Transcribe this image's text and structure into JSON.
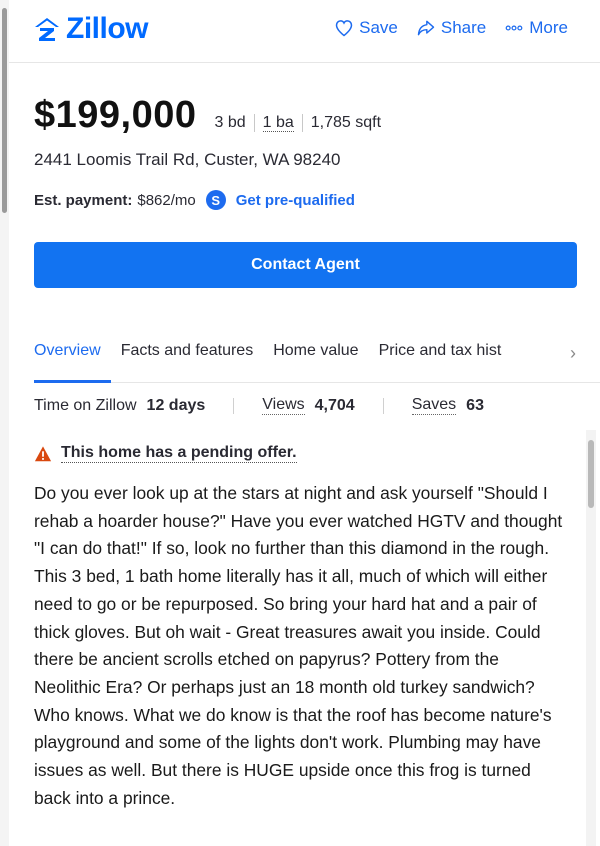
{
  "header": {
    "brand": "Zillow",
    "actions": [
      {
        "label": "Save",
        "icon": "heart-icon"
      },
      {
        "label": "Share",
        "icon": "share-icon"
      },
      {
        "label": "More",
        "icon": "more-dots-icon"
      }
    ]
  },
  "listing": {
    "price": "$199,000",
    "beds": "3 bd",
    "baths": "1 ba",
    "sqft": "1,785 sqft",
    "address": "2441 Loomis Trail Rd, Custer, WA 98240",
    "payment_label": "Est. payment:",
    "payment_value": "$862/mo",
    "prequal_icon_letter": "S",
    "prequal_link": "Get pre-qualified"
  },
  "contact": {
    "label": "Contact Agent"
  },
  "tabs": [
    {
      "label": "Overview",
      "active": true
    },
    {
      "label": "Facts and features",
      "active": false
    },
    {
      "label": "Home value",
      "active": false
    },
    {
      "label": "Price and tax hist",
      "active": false
    }
  ],
  "stats": {
    "time_label": "Time on Zillow",
    "time_value": "12 days",
    "views_label": "Views",
    "views_value": "4,704",
    "saves_label": "Saves",
    "saves_value": "63"
  },
  "pending": {
    "text": "This home has a pending offer."
  },
  "description": "Do you ever look up at the stars at night and ask yourself \"Should I rehab a hoarder house?\" Have you ever watched HGTV and thought \"I can do that!\" If so, look no further than this diamond in the rough. This 3 bed, 1 bath home literally has it all, much of which will either need to go or be repurposed. So bring your hard hat and a pair of thick gloves. But oh wait - Great treasures await you inside. Could there be ancient scrolls etched on papyrus? Pottery from the Neolithic Era? Or perhaps just an 18 month old turkey sandwich? Who knows. What we do know is that the roof has become nature's playground and some of the lights don't work. Plumbing may have issues as well. But there is HUGE upside once this frog is turned back into a prince.",
  "colors": {
    "accent": "#1d6bef",
    "button": "#1273f1",
    "brand": "#006aff",
    "warning": "#d9480f"
  }
}
